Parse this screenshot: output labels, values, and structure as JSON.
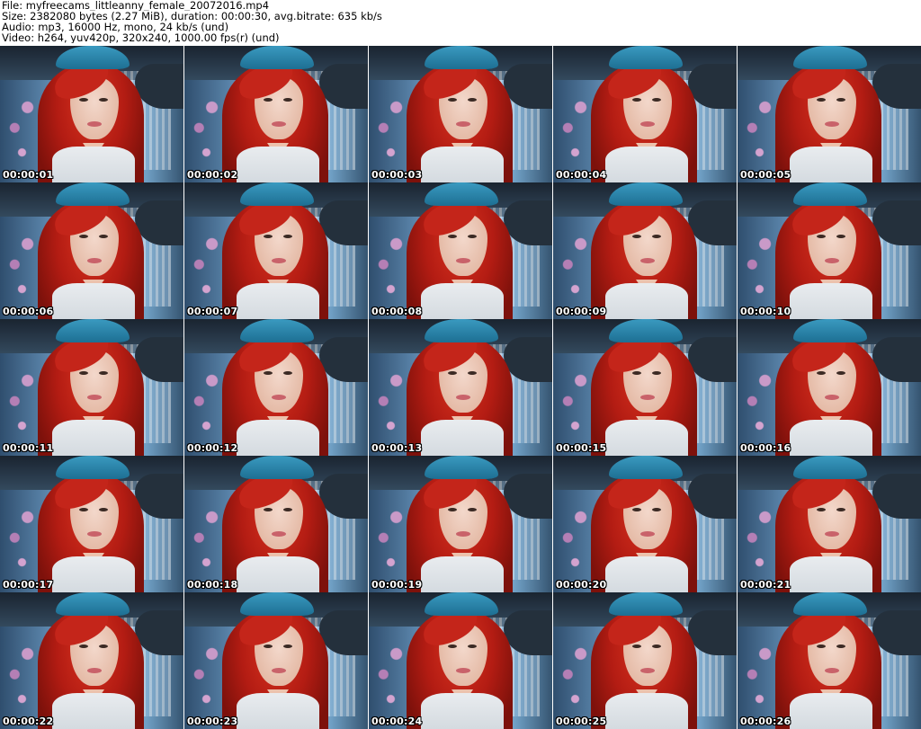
{
  "header": {
    "file": "File: myfreecams_littleanny_female_20072016.mp4",
    "size": "Size: 2382080 bytes (2.27 MiB), duration: 00:00:30, avg.bitrate: 635 kb/s",
    "audio": "Audio: mp3, 16000 Hz, mono, 24 kb/s (und)",
    "video": "Video: h264, yuv420p, 320x240, 1000.00 fps(r) (und)"
  },
  "thumbnails": [
    {
      "timestamp": "00:00:01"
    },
    {
      "timestamp": "00:00:02"
    },
    {
      "timestamp": "00:00:03"
    },
    {
      "timestamp": "00:00:04"
    },
    {
      "timestamp": "00:00:05"
    },
    {
      "timestamp": "00:00:06"
    },
    {
      "timestamp": "00:00:07"
    },
    {
      "timestamp": "00:00:08"
    },
    {
      "timestamp": "00:00:09"
    },
    {
      "timestamp": "00:00:10"
    },
    {
      "timestamp": "00:00:11"
    },
    {
      "timestamp": "00:00:12"
    },
    {
      "timestamp": "00:00:13"
    },
    {
      "timestamp": "00:00:15"
    },
    {
      "timestamp": "00:00:16"
    },
    {
      "timestamp": "00:00:17"
    },
    {
      "timestamp": "00:00:18"
    },
    {
      "timestamp": "00:00:19"
    },
    {
      "timestamp": "00:00:20"
    },
    {
      "timestamp": "00:00:21"
    },
    {
      "timestamp": "00:00:22"
    },
    {
      "timestamp": "00:00:23"
    },
    {
      "timestamp": "00:00:24"
    },
    {
      "timestamp": "00:00:25"
    },
    {
      "timestamp": "00:00:26"
    }
  ]
}
